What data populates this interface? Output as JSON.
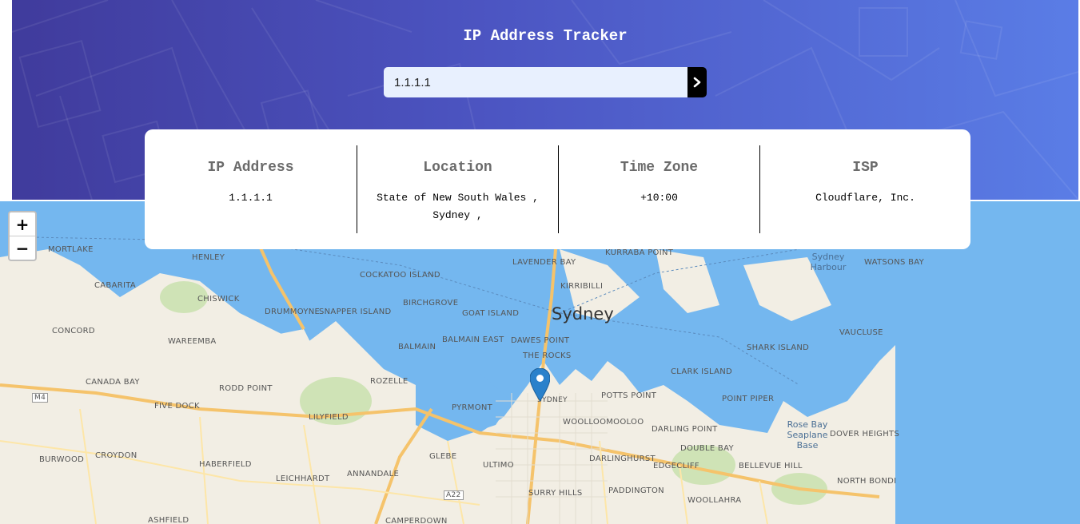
{
  "header": {
    "title": "IP Address Tracker"
  },
  "search": {
    "value": "1.1.1.1",
    "submit_icon": "chevron-right-icon"
  },
  "info": {
    "ip": {
      "label": "IP Address",
      "value": "1.1.1.1"
    },
    "location": {
      "label": "Location",
      "value": "State of New South Wales , Sydney ,"
    },
    "timezone": {
      "label": "Time Zone",
      "value": "+10:00"
    },
    "isp": {
      "label": "ISP",
      "value": "Cloudflare, Inc."
    }
  },
  "map": {
    "zoom_in": "+",
    "zoom_out": "−",
    "city": "Sydney",
    "labels": [
      "MORTLAKE",
      "HENLEY",
      "CABARITA",
      "CHISWICK",
      "CONCORD",
      "WAREEMBA",
      "DRUMMOYNE",
      "CANADA BAY",
      "RODD POINT",
      "FIVE DOCK",
      "CROYDON",
      "BURWOOD",
      "HABERFIELD",
      "LEICHHARDT",
      "ANNANDALE",
      "ASHFIELD",
      "LILYFIELD",
      "ROZELLE",
      "BALMAIN",
      "BIRCHGROVE",
      "COCKATOO ISLAND",
      "SNAPPER ISLAND",
      "GOAT ISLAND",
      "BALMAIN EAST",
      "DAWES POINT",
      "THE ROCKS",
      "PYRMONT",
      "GLEBE",
      "ULTIMO",
      "CAMPERDOWN",
      "SURRY HILLS",
      "PADDINGTON",
      "WOOLLAHRA",
      "DARLINGHURST",
      "WOOLLOOMOOLOO",
      "POTTS POINT",
      "DARLING POINT",
      "DOUBLE BAY",
      "EDGECLIFF",
      "BELLEVUE HILL",
      "POINT PIPER",
      "CLARK ISLAND",
      "SHARK ISLAND",
      "VAUCLUSE",
      "DOVER HEIGHTS",
      "NORTH BONDI",
      "KURRABA POINT",
      "LAVENDER BAY",
      "KIRRIBILLI",
      "WATSONS BAY",
      "Sydney Harbour",
      "Rose Bay Seaplane Base",
      "SYDNEY",
      "M4",
      "A22"
    ],
    "colors": {
      "water": "#74b7ef",
      "land": "#f2eee4",
      "road": "#f5c36b",
      "marker": "#2a81cb"
    }
  }
}
